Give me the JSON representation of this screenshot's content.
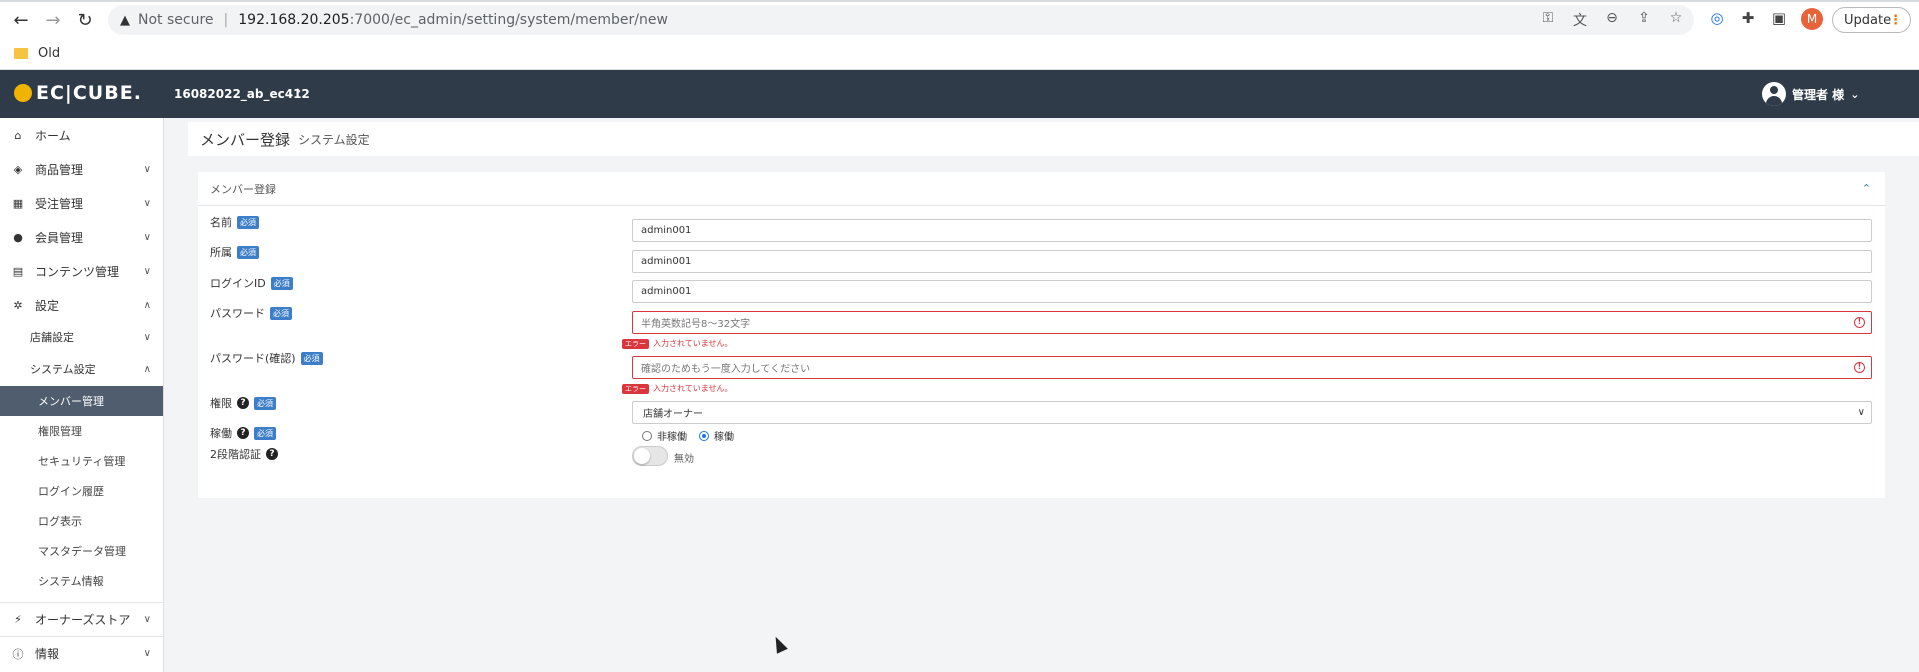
{
  "browser": {
    "not_secure": "Not secure",
    "url_host": "192.168.20.205",
    "url_path": ":7000/ec_admin/setting/system/member/new",
    "profile_initial": "M",
    "update_label": "Update",
    "bookmark": "Old"
  },
  "header": {
    "logo_text": "EC|CUBE.",
    "shop_name": "16082022_ab_ec412",
    "user_name": "管理者 様"
  },
  "sidebar": {
    "items": [
      {
        "label": "ホーム",
        "icon": "home-icon"
      },
      {
        "label": "商品管理",
        "icon": "cube-icon"
      },
      {
        "label": "受注管理",
        "icon": "cart-icon"
      },
      {
        "label": "会員管理",
        "icon": "users-icon"
      },
      {
        "label": "コンテンツ管理",
        "icon": "file-icon"
      },
      {
        "label": "設定",
        "icon": "gear-icon"
      },
      {
        "label": "店舗設定"
      },
      {
        "label": "システム設定"
      },
      {
        "label": "メンバー管理"
      },
      {
        "label": "権限管理"
      },
      {
        "label": "セキュリティ管理"
      },
      {
        "label": "ログイン履歴"
      },
      {
        "label": "ログ表示"
      },
      {
        "label": "マスタデータ管理"
      },
      {
        "label": "システム情報"
      },
      {
        "label": "オーナーズストア",
        "icon": "plug-icon"
      },
      {
        "label": "情報",
        "icon": "info-icon"
      }
    ]
  },
  "page": {
    "title": "メンバー登録",
    "subtitle": "システム設定"
  },
  "card": {
    "title": "メンバー登録",
    "required_badge": "必須",
    "error_tag": "エラー",
    "fields": {
      "name": {
        "label": "名前",
        "value": "admin001"
      },
      "department": {
        "label": "所属",
        "value": "admin001"
      },
      "login_id": {
        "label": "ログインID",
        "value": "admin001"
      },
      "password": {
        "label": "パスワード",
        "placeholder": "半角英数記号8〜32文字",
        "error": "入力されていません。"
      },
      "password_confirm": {
        "label": "パスワード(確認)",
        "placeholder": "確認のためもう一度入力してください",
        "error": "入力されていません。"
      },
      "authority": {
        "label": "権限",
        "value": "店舗オーナー"
      },
      "work": {
        "label": "稼働",
        "options": [
          "非稼働",
          "稼働"
        ],
        "selected": "稼働"
      },
      "two_factor": {
        "label": "2段階認証",
        "toggle_label": "無効",
        "enabled": false
      }
    }
  }
}
